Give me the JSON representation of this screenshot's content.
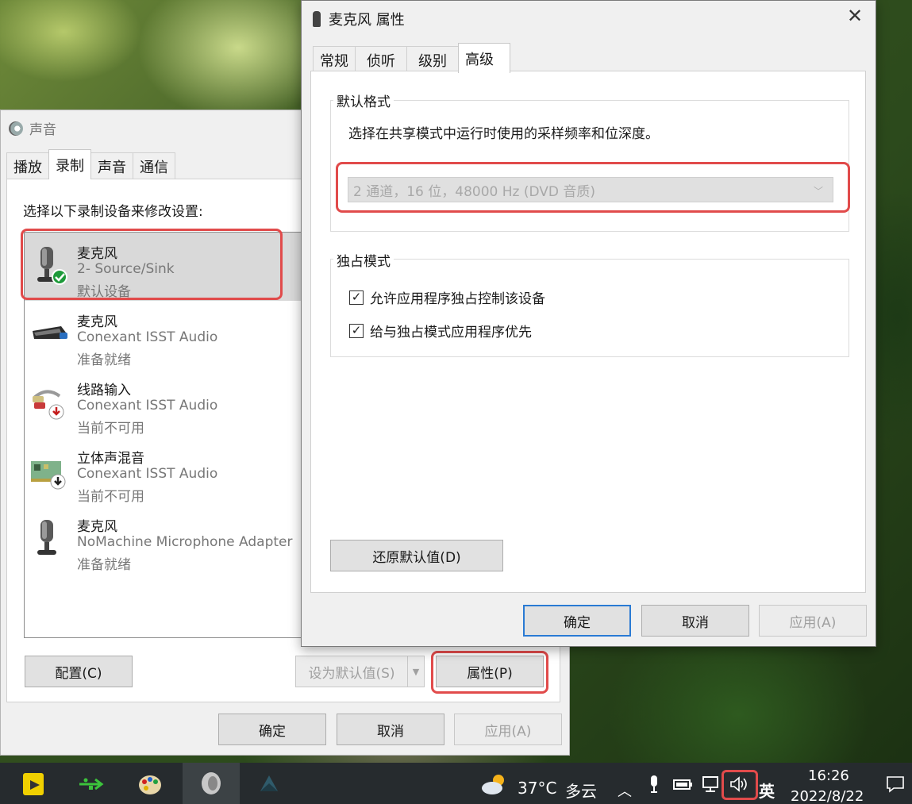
{
  "sound_window": {
    "title": "声音",
    "tabs": [
      "播放",
      "录制",
      "声音",
      "通信"
    ],
    "active_tab": "录制",
    "instruction": "选择以下录制设备来修改设置:",
    "devices": [
      {
        "name": "麦克风",
        "source": "2- Source/Sink",
        "status": "默认设备",
        "icon": "microphone-default-icon"
      },
      {
        "name": "麦克风",
        "source": "Conexant ISST Audio",
        "status": "准备就绪",
        "icon": "webcam-microphone-icon"
      },
      {
        "name": "线路输入",
        "source": "Conexant ISST Audio",
        "status": "当前不可用",
        "icon": "line-in-cable-icon"
      },
      {
        "name": "立体声混音",
        "source": "Conexant ISST Audio",
        "status": "当前不可用",
        "icon": "sound-card-icon"
      },
      {
        "name": "麦克风",
        "source": "NoMachine Microphone Adapter",
        "status": "准备就绪",
        "icon": "microphone-icon"
      }
    ],
    "configure_button": "配置(C)",
    "set_default_button": "设为默认值(S)",
    "properties_button": "属性(P)",
    "ok_button": "确定",
    "cancel_button": "取消",
    "apply_button": "应用(A)"
  },
  "props_dialog": {
    "title": "麦克风 属性",
    "tabs": [
      "常规",
      "侦听",
      "级别",
      "高级"
    ],
    "active_tab": "高级",
    "default_format": {
      "legend": "默认格式",
      "description": "选择在共享模式中运行时使用的采样频率和位深度。",
      "selected_value": "2 通道，16 位，48000 Hz (DVD 音质)"
    },
    "exclusive_mode": {
      "legend": "独占模式",
      "allow_exclusive": {
        "label": "允许应用程序独占控制该设备",
        "checked": true
      },
      "give_priority": {
        "label": "给与独占模式应用程序优先",
        "checked": true
      }
    },
    "restore_defaults_button": "还原默认值(D)",
    "ok_button": "确定",
    "cancel_button": "取消",
    "apply_button": "应用(A)"
  },
  "taskbar": {
    "weather_temp": "37°C",
    "weather_desc": "多云",
    "ime": "英",
    "time": "16:26",
    "date": "2022/8/22"
  },
  "colors": {
    "highlight_red": "#e14b4b",
    "primary_border": "#2a7ad4",
    "taskbar": "#262b2e"
  }
}
